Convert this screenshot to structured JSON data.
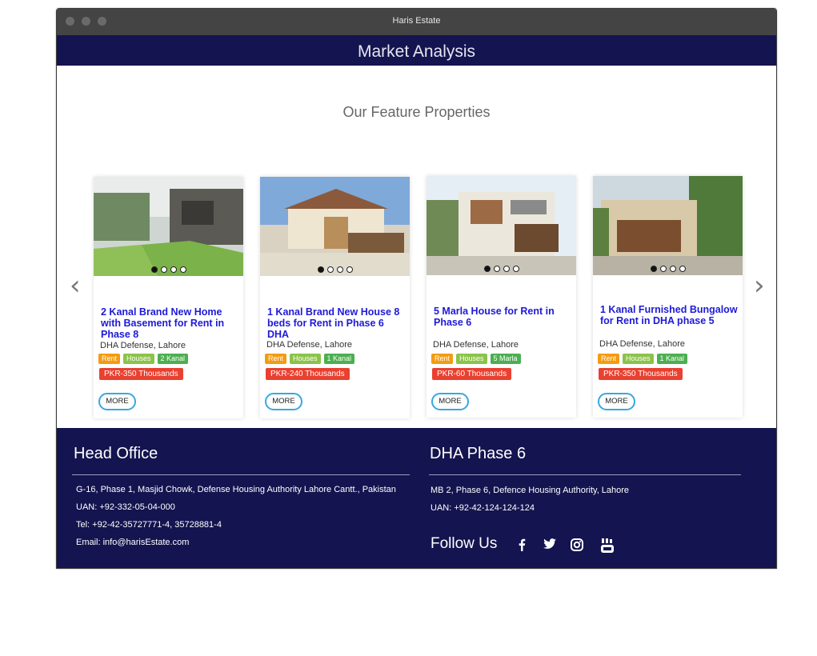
{
  "window": {
    "title": "Haris Estate"
  },
  "banner": {
    "title": "Market Analysis"
  },
  "section": {
    "title": "Our Feature Properties"
  },
  "nav": {
    "prev": "‹",
    "next": "›"
  },
  "cards": [
    {
      "name": "2 Kanal Brand New Home with Basement for Rent in Phase 8",
      "location": "DHA Defense, Lahore",
      "tags": [
        "Rent",
        "Houses",
        "2 Kanal"
      ],
      "price": "PKR-350 Thousands",
      "more": "MORE"
    },
    {
      "name": "1 Kanal Brand New House 8 beds for Rent in Phase 6 DHA",
      "location": "DHA Defense, Lahore",
      "tags": [
        "Rent",
        "Houses",
        "1 Kanal"
      ],
      "price": "PKR-240 Thousands",
      "more": "MORE"
    },
    {
      "name": "5 Marla House for Rent in Phase 6",
      "location": "DHA Defense, Lahore",
      "tags": [
        "Rent",
        "Houses",
        "5 Marla"
      ],
      "price": "PKR-60 Thousands",
      "more": "MORE"
    },
    {
      "name": "1 Kanal Furnished Bungalow for Rent in DHA phase 5",
      "location": "DHA Defense, Lahore",
      "tags": [
        "Rent",
        "Houses",
        "1 Kanal"
      ],
      "price": "PKR-350 Thousands",
      "more": "MORE"
    }
  ],
  "footer": {
    "head_office": {
      "title": "Head Office",
      "address": "G-16, Phase 1, Masjid Chowk, Defense Housing Authority Lahore Cantt., Pakistan",
      "uan": "UAN: +92-332-05-04-000",
      "tel": "Tel: +92-42-35727771-4, 35728881-4",
      "email": "Email: info@harisEstate.com"
    },
    "phase6": {
      "title": "DHA Phase 6",
      "address": "MB 2, Phase 6, Defence Housing Authority, Lahore",
      "uan": "UAN: +92-42-124-124-124"
    },
    "follow_us": "Follow Us",
    "social_icons": [
      "facebook-icon",
      "twitter-icon",
      "instagram-icon",
      "youtube-icon"
    ]
  },
  "colors": {
    "navy": "#141450",
    "link": "#1d1ad8",
    "rent": "#f39c12",
    "houses": "#8bc34a",
    "size": "#4caf50",
    "price": "#e9402f",
    "more_border": "#3aa7e0"
  }
}
